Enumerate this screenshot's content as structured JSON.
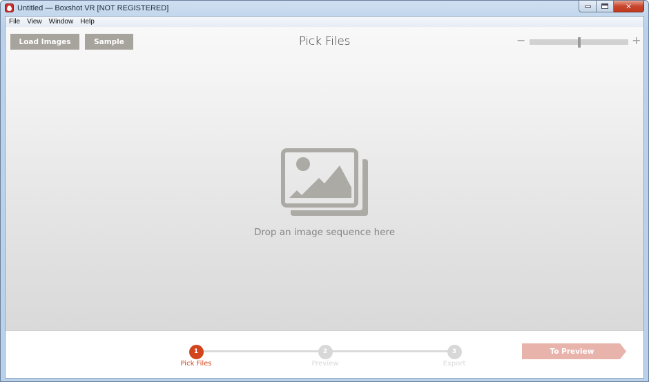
{
  "window": {
    "title": "Untitled — Boxshot VR [NOT REGISTERED]",
    "app_icon": "boxshot-app-icon",
    "controls": {
      "minimize": "minimize-icon",
      "maximize": "maximize-icon",
      "close_glyph": "✕"
    }
  },
  "menu": {
    "items": [
      {
        "label": "File"
      },
      {
        "label": "View"
      },
      {
        "label": "Window"
      },
      {
        "label": "Help"
      }
    ]
  },
  "toolbar": {
    "load_images_label": "Load Images",
    "sample_label": "Sample",
    "page_title": "Pick Files",
    "zoom": {
      "minus_glyph": "−",
      "plus_glyph": "+",
      "value_fraction": 0.5
    }
  },
  "dropzone": {
    "icon": "image-gallery-icon",
    "text": "Drop an image sequence here"
  },
  "wizard": {
    "steps": [
      {
        "number": "1",
        "label": "Pick Files",
        "active": true
      },
      {
        "number": "2",
        "label": "Preview",
        "active": false
      },
      {
        "number": "3",
        "label": "Export",
        "active": false
      }
    ],
    "next_label": "To Preview"
  },
  "colors": {
    "accent": "#d2451e",
    "button_gray": "#a7a39d",
    "next_disabled": "#e8b3ab"
  }
}
